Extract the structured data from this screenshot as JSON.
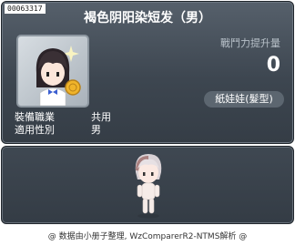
{
  "item": {
    "id": "00063317",
    "title": "褐色阴阳染短发（男）"
  },
  "stats": {
    "label": "戰鬥力提升量",
    "value": "0"
  },
  "tag": "紙娃娃(髮型)",
  "info": {
    "job_label": "裝備職業",
    "job_value": "共用",
    "gender_label": "適用性別",
    "gender_value": "男"
  },
  "footer": "@ 数据由小册子整理, WzComparerR2-NTMS解析 @",
  "icons": {
    "item_icon": "hair-avatar-icon",
    "preview": "character-preview"
  },
  "colors": {
    "panel": "#3d4650",
    "title_text": "#ffffff",
    "muted_text": "#b7c0c8"
  }
}
